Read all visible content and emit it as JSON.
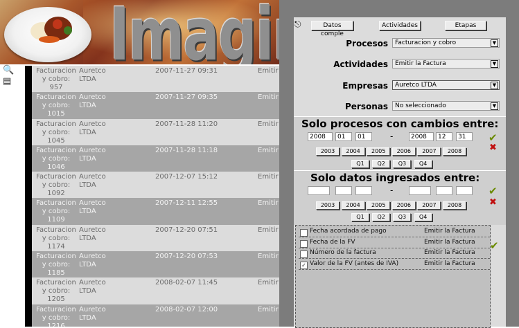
{
  "banner": {
    "title": "Imaginar"
  },
  "rows": [
    {
      "proceso": "Facturacion y cobro: 957",
      "empresa": "Auretco LTDA",
      "fecha": "2007-11-27 09:31",
      "actividad": "Emitir"
    },
    {
      "proceso": "Facturacion y cobro: 1015",
      "empresa": "Auretco LTDA",
      "fecha": "2007-11-27 09:35",
      "actividad": "Emitir"
    },
    {
      "proceso": "Facturacion y cobro: 1045",
      "empresa": "Auretco LTDA",
      "fecha": "2007-11-28 11:20",
      "actividad": "Emitir"
    },
    {
      "proceso": "Facturacion y cobro: 1046",
      "empresa": "Auretco LTDA",
      "fecha": "2007-11-28 11:18",
      "actividad": "Emitir"
    },
    {
      "proceso": "Facturacion y cobro: 1092",
      "empresa": "Auretco LTDA",
      "fecha": "2007-12-07 15:12",
      "actividad": "Emitir"
    },
    {
      "proceso": "Facturacion y cobro: 1109",
      "empresa": "Auretco LTDA",
      "fecha": "2007-12-11 12:55",
      "actividad": "Emitir"
    },
    {
      "proceso": "Facturacion y cobro: 1174",
      "empresa": "Auretco LTDA",
      "fecha": "2007-12-20 07:51",
      "actividad": "Emitir"
    },
    {
      "proceso": "Facturacion y cobro: 1185",
      "empresa": "Auretco LTDA",
      "fecha": "2007-12-20 07:53",
      "actividad": "Emitir"
    },
    {
      "proceso": "Facturacion y cobro: 1205",
      "empresa": "Auretco LTDA",
      "fecha": "2008-02-07 11:45",
      "actividad": "Emitir"
    },
    {
      "proceso": "Facturacion y cobro: 1216",
      "empresa": "Auretco LTDA",
      "fecha": "2008-02-07 12:00",
      "actividad": "Emitir"
    }
  ],
  "panel": {
    "tabs": [
      "Datos comple",
      "Actividades",
      "Etapas"
    ],
    "filters": [
      {
        "label": "Procesos",
        "value": "Facturacion y cobro"
      },
      {
        "label": "Actividades",
        "value": "Emitir la Factura"
      },
      {
        "label": "Empresas",
        "value": "Auretco LTDA"
      },
      {
        "label": "Personas",
        "value": "No seleccionado"
      }
    ],
    "changes": {
      "title": "Solo procesos con cambios entre:",
      "from": [
        "2008",
        "01",
        "01"
      ],
      "to": [
        "2008",
        "12",
        "31"
      ],
      "years": [
        "2003",
        "2004",
        "2005",
        "2006",
        "2007",
        "2008"
      ],
      "quarters": [
        "Q1",
        "Q2",
        "Q3",
        "Q4"
      ]
    },
    "entered": {
      "title": "Solo datos ingresados entre:",
      "from": [
        "",
        "",
        ""
      ],
      "to": [
        "",
        "",
        ""
      ],
      "years": [
        "2003",
        "2004",
        "2005",
        "2006",
        "2007",
        "2008"
      ],
      "quarters": [
        "Q1",
        "Q2",
        "Q3",
        "Q4"
      ]
    },
    "dash": "-",
    "fields": [
      {
        "name": "Fecha acordada de pago",
        "activity": "Emitir la Factura",
        "checked": false
      },
      {
        "name": "Fecha de la FV",
        "activity": "Emitir la Factura",
        "checked": false
      },
      {
        "name": "Número de la factura",
        "activity": "Emitir la Factura",
        "checked": false
      },
      {
        "name": "Valor de la FV (antes de IVA)",
        "activity": "Emitir la Factura",
        "checked": true
      }
    ],
    "colors": {
      "ok": "#6a8a00",
      "cancel": "#c01010",
      "panel": "#dcdcdc",
      "outer": "#7c7c7c"
    }
  }
}
